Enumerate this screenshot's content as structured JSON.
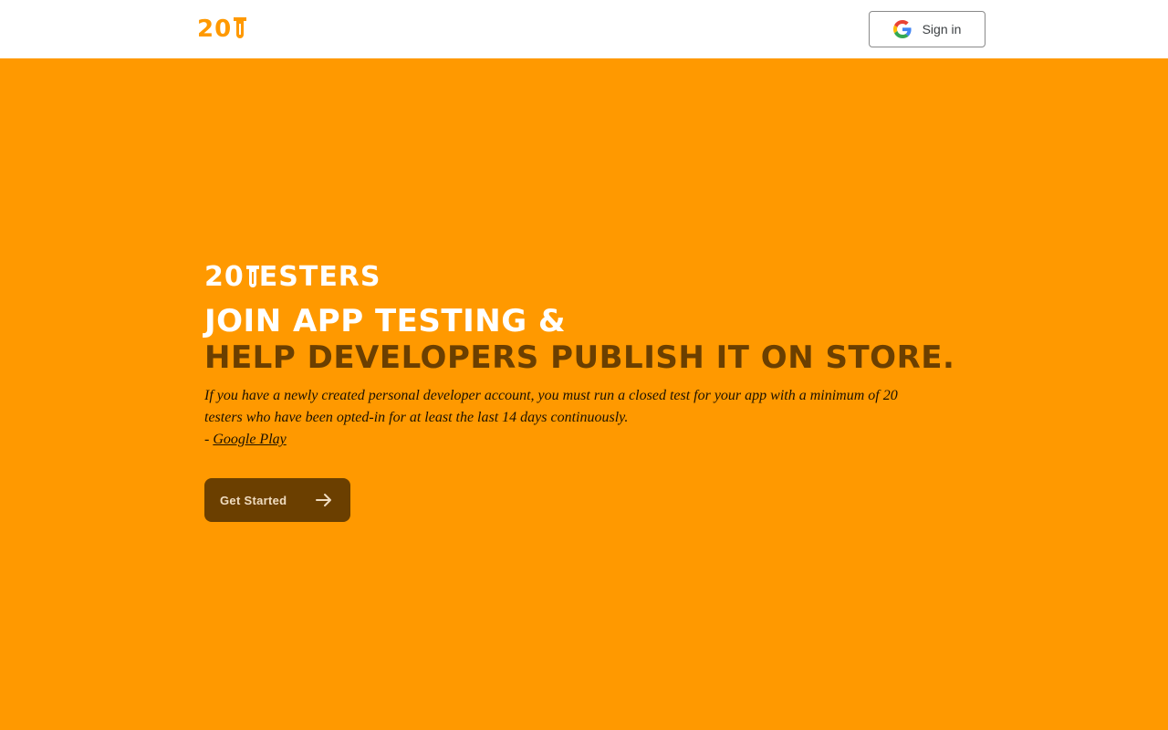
{
  "header": {
    "logo_text": "20",
    "signin_label": "Sign in"
  },
  "hero": {
    "brand_number": "20",
    "brand_word": "ESTERS",
    "headline_line1": "Join App Testing &",
    "headline_line2": "Help Developers publish it on store.",
    "quote_text": "If you have a newly created personal developer account, you must run a closed test for your app with a minimum of 20 testers who have been opted-in for at least the last 14 days continuously.",
    "quote_prefix": "- ",
    "quote_source": "Google Play",
    "cta_label": "Get Started"
  },
  "icons": {
    "logo": "test-tube-icon",
    "signin": "google-icon",
    "cta": "arrow-right-icon"
  },
  "colors": {
    "background": "#ff9900",
    "accent_dark": "#6b3f00",
    "header_bg": "#ffffff"
  }
}
